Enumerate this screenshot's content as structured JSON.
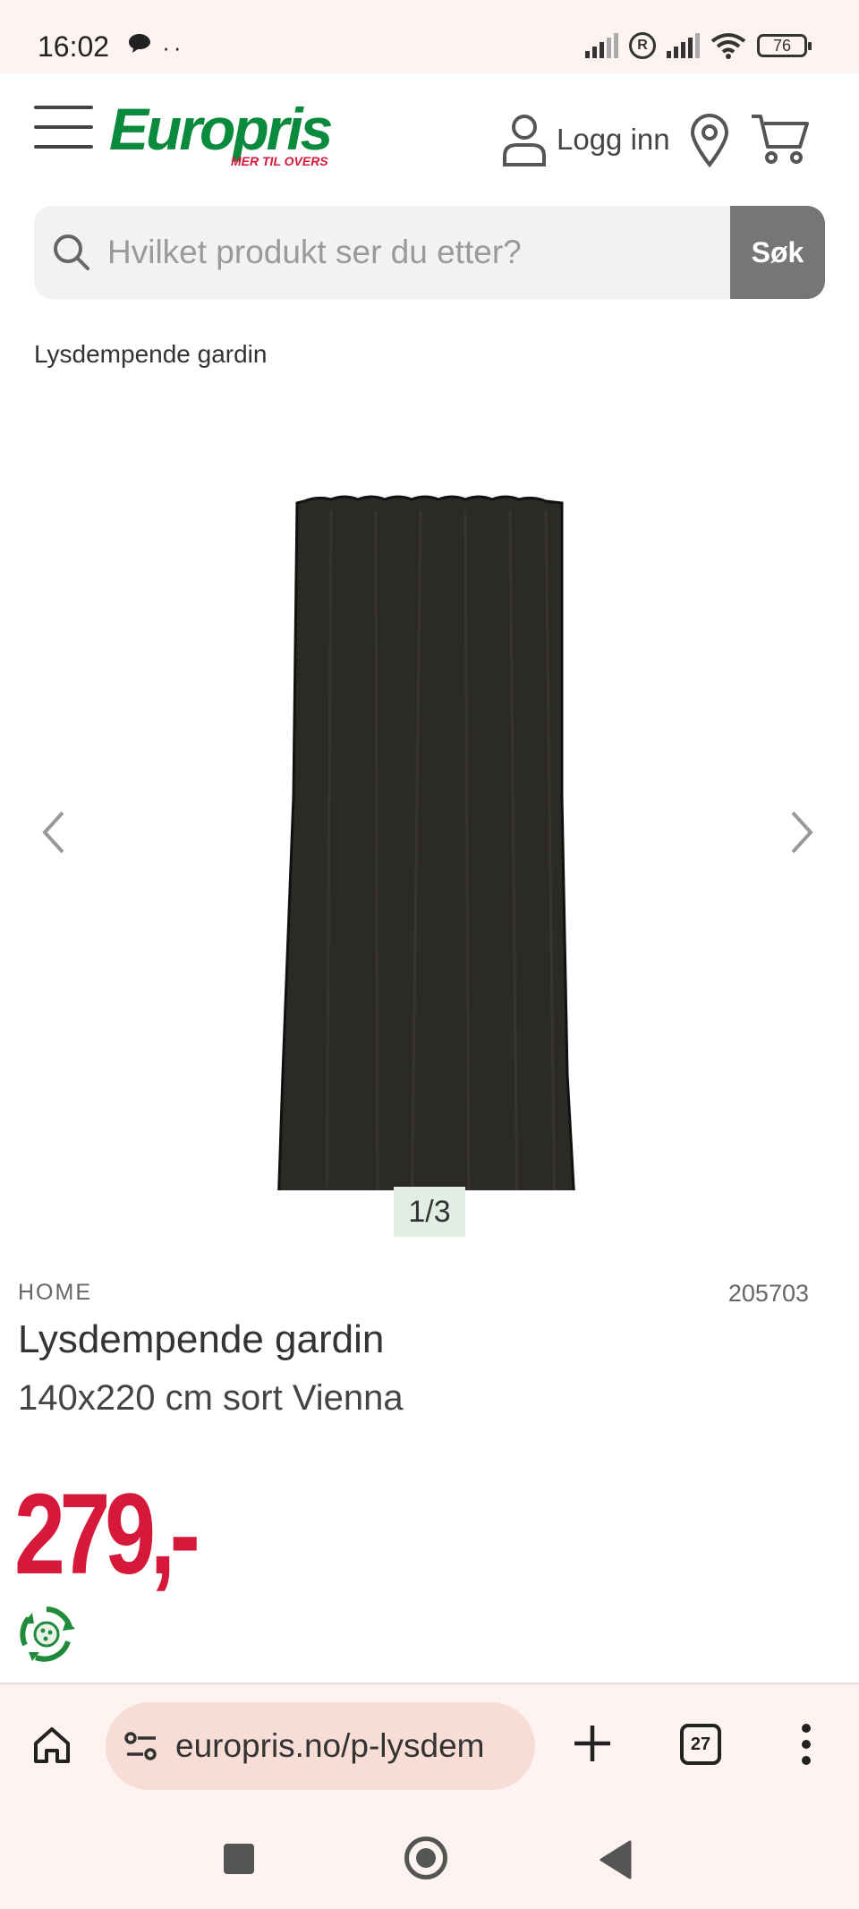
{
  "status_bar": {
    "time": "16:02",
    "left_icons": "chat-icon, more-dots",
    "battery": "76"
  },
  "header": {
    "logo_text": "Europris",
    "logo_tagline": "MER TIL OVERS",
    "login_label": "Logg inn",
    "icons": [
      "menu-icon",
      "user-icon",
      "location-pin-icon",
      "cart-icon"
    ]
  },
  "search": {
    "placeholder": "Hvilket produkt ser du etter?",
    "button_label": "Søk"
  },
  "breadcrumb": "Lysdempende gardin",
  "gallery": {
    "counter": "1/3"
  },
  "product": {
    "brand": "HOME",
    "sku": "205703",
    "title": "Lysdempende gardin",
    "subtitle": "140x220 cm sort Vienna",
    "price": "279,-"
  },
  "browser": {
    "url": "europris.no/p-lysdem",
    "tab_count": "27"
  },
  "colors": {
    "brand_green": "#0a8a3c",
    "price_red": "#d6193a",
    "search_button": "#767676",
    "browser_bar": "#fdf3f1"
  }
}
